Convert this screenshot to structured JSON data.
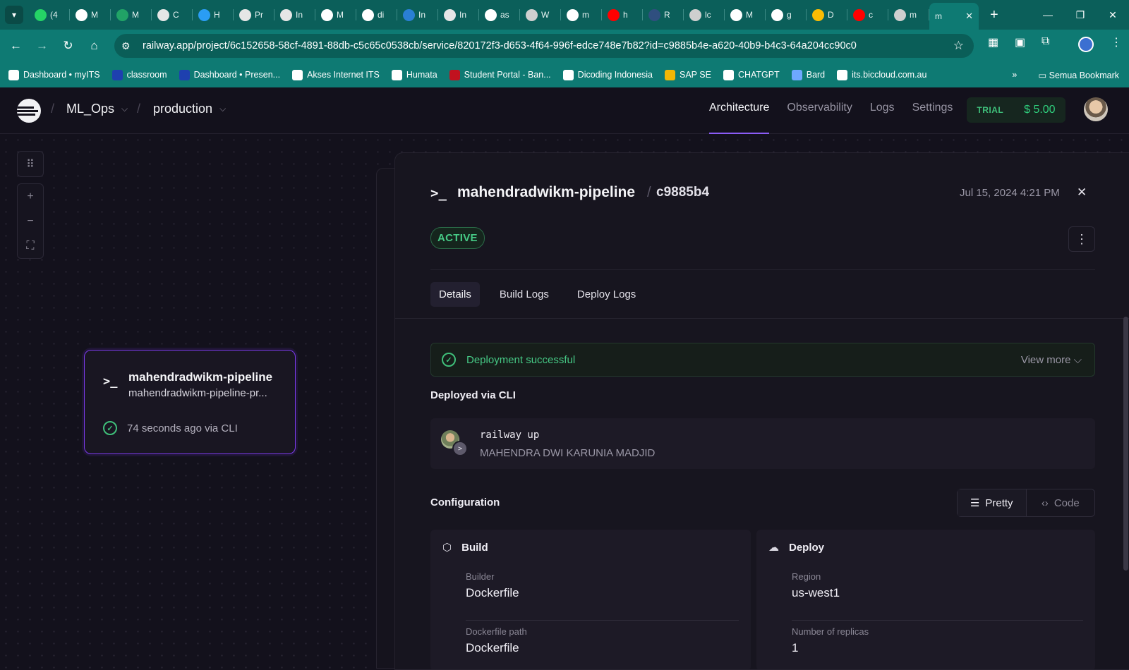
{
  "browser": {
    "tabs": [
      {
        "label": "(4",
        "fav": "#25d366"
      },
      {
        "label": "M",
        "fav": "#ffffff"
      },
      {
        "label": "M",
        "fav": "#21a366"
      },
      {
        "label": "C",
        "fav": "#e6e6e6"
      },
      {
        "label": "H",
        "fav": "#2a9df4"
      },
      {
        "label": "Pr",
        "fav": "#e6e6e6"
      },
      {
        "label": "In",
        "fav": "#e6e6e6"
      },
      {
        "label": "M",
        "fav": "#ffffff"
      },
      {
        "label": "di",
        "fav": "#ffffff"
      },
      {
        "label": "In",
        "fav": "#2a7fd4"
      },
      {
        "label": "In",
        "fav": "#e6e6e6"
      },
      {
        "label": "as",
        "fav": "#ffffff"
      },
      {
        "label": "W",
        "fav": "#cfcfcf"
      },
      {
        "label": "m",
        "fav": "#ffffff"
      },
      {
        "label": "h",
        "fav": "#ff0000"
      },
      {
        "label": "R",
        "fav": "#2f4f7f"
      },
      {
        "label": "lc",
        "fav": "#cfcfcf"
      },
      {
        "label": "M",
        "fav": "#ffffff"
      },
      {
        "label": "g",
        "fav": "#ffffff"
      },
      {
        "label": "D",
        "fav": "#fbbc04"
      },
      {
        "label": "c",
        "fav": "#ff0000"
      },
      {
        "label": "m",
        "fav": "#cfcfcf"
      }
    ],
    "active_tab_label": "m",
    "url": "railway.app/project/6c152658-58cf-4891-88db-c5c65c0538cb/service/820172f3-d653-4f64-996f-edce748e7b82?id=c9885b4e-a620-40b9-b4c3-64a204cc90c0",
    "bookmarks": [
      {
        "label": "Dashboard • myITS",
        "color": "#ffffff"
      },
      {
        "label": "classroom",
        "color": "#1e40af"
      },
      {
        "label": "Dashboard • Presen...",
        "color": "#1e40af"
      },
      {
        "label": "Akses Internet ITS",
        "color": "#ffffff"
      },
      {
        "label": "Humata",
        "color": "#ffffff"
      },
      {
        "label": "Student Portal - Ban...",
        "color": "#c1121f"
      },
      {
        "label": "Dicoding Indonesia",
        "color": "#ffffff"
      },
      {
        "label": "SAP SE",
        "color": "#f2b705"
      },
      {
        "label": "CHATGPT",
        "color": "#ffffff"
      },
      {
        "label": "Bard",
        "color": "#6ea8fe"
      },
      {
        "label": "its.biccloud.com.au",
        "color": "#ffffff"
      }
    ],
    "all_bookmarks_label": "Semua Bookmark",
    "more_bookmarks": "»"
  },
  "app": {
    "project": "ML_Ops",
    "environment": "production",
    "nav": [
      "Architecture",
      "Observability",
      "Logs",
      "Settings"
    ],
    "trial_label": "TRIAL",
    "credit": "$ 5.00"
  },
  "canvas": {
    "card": {
      "icon": ">_",
      "name": "mahendradwikm-pipeline",
      "domain": "mahendradwikm-pipeline-pr...",
      "status": "74 seconds ago via CLI"
    }
  },
  "panel": {
    "icon": ">_",
    "service": "mahendradwikm-pipeline",
    "separator": "/",
    "deploy_id": "c9885b4",
    "date": "Jul 15, 2024 4:21 PM",
    "status": "ACTIVE",
    "tabs": [
      "Details",
      "Build Logs",
      "Deploy Logs"
    ],
    "banner": {
      "message": "Deployment successful",
      "more": "View more"
    },
    "deployed_via_title": "Deployed via CLI",
    "command": "railway up",
    "author": "MAHENDRA DWI KARUNIA MADJID",
    "config_title": "Configuration",
    "view_pretty": "Pretty",
    "view_code": "Code",
    "build": {
      "title": "Build",
      "builder_label": "Builder",
      "builder_value": "Dockerfile",
      "path_label": "Dockerfile path",
      "path_value": "Dockerfile"
    },
    "deploy": {
      "title": "Deploy",
      "region_label": "Region",
      "region_value": "us-west1",
      "replicas_label": "Number of replicas",
      "replicas_value": "1"
    }
  }
}
